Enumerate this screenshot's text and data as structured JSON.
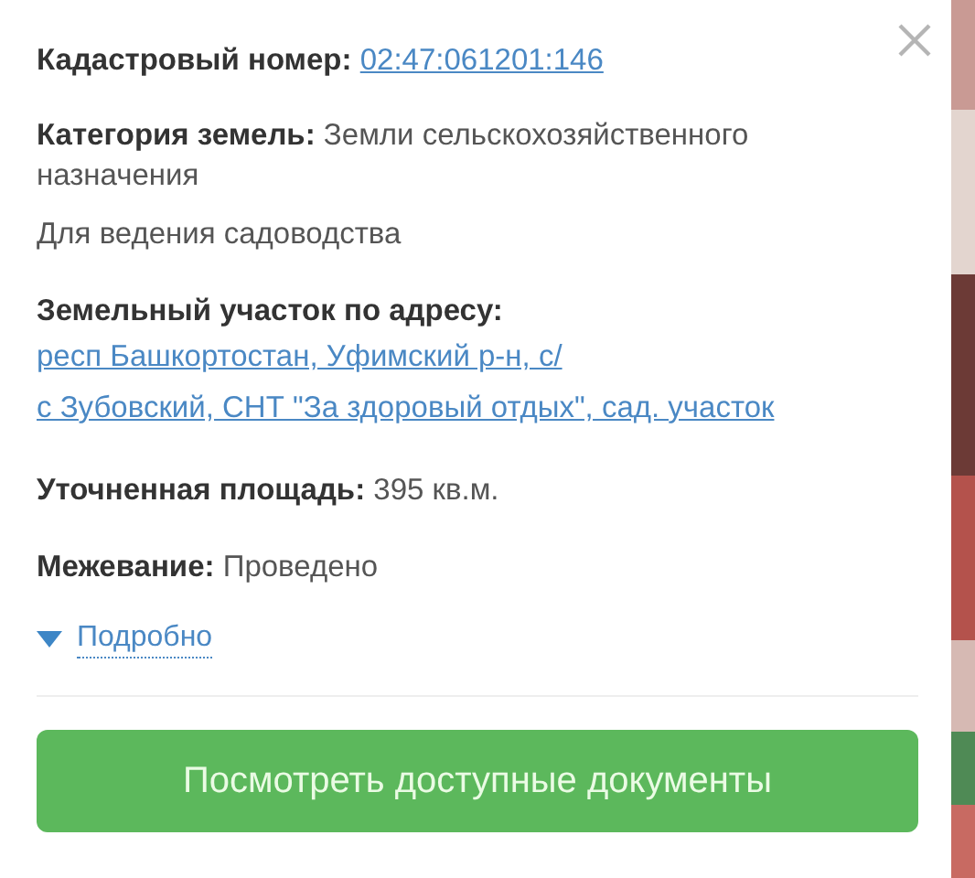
{
  "fields": [
    {
      "kind": "link",
      "label": "Кадастровый номер:",
      "value": "02:47:061201:146"
    },
    {
      "kind": "text",
      "label": "Категория земель:",
      "value": "Земли сельскохозяйственного назначения",
      "note": "Для ведения садоводства"
    },
    {
      "kind": "address",
      "label": "Земельный участок по адресу:",
      "lines": [
        "респ Башкортостан, Уфимский р-н, с/",
        "с Зубовский, СНТ \"За здоровый отдых\", сад. участок"
      ]
    },
    {
      "kind": "text",
      "label": "Уточненная площадь:",
      "value": "395 кв.м."
    },
    {
      "kind": "text",
      "label": "Межевание:",
      "value": "Проведено"
    }
  ],
  "details_toggle": {
    "label": "Подробно",
    "expanded": false
  },
  "action_button": "Посмотреть доступные документы"
}
